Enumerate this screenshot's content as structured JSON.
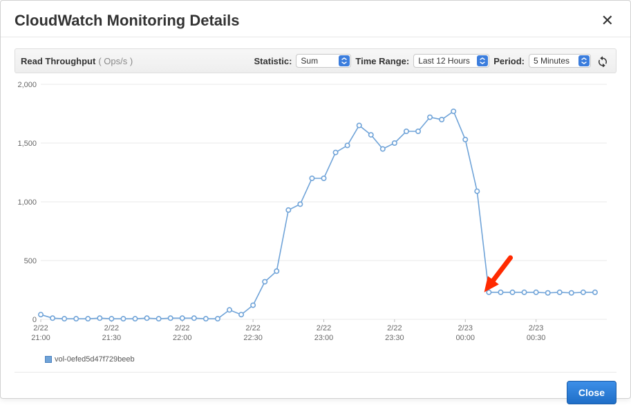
{
  "header": {
    "title": "CloudWatch Monitoring Details"
  },
  "toolbar": {
    "metric_name": "Read Throughput",
    "metric_unit": "( Ops/s )",
    "statistic_label": "Statistic:",
    "statistic_value": "Sum",
    "time_range_label": "Time Range:",
    "time_range_value": "Last 12 Hours",
    "period_label": "Period:",
    "period_value": "5 Minutes"
  },
  "legend": {
    "series_name": "vol-0efed5d47f729beeb"
  },
  "footer": {
    "close_label": "Close"
  },
  "chart_data": {
    "type": "line",
    "title": "",
    "xlabel": "",
    "ylabel": "",
    "ylim": [
      0,
      2000
    ],
    "y_ticks": [
      0,
      500,
      1000,
      1500,
      2000
    ],
    "x_ticks": [
      {
        "minutes": 0,
        "top": "2/22",
        "bottom": "21:00"
      },
      {
        "minutes": 30,
        "top": "2/22",
        "bottom": "21:30"
      },
      {
        "minutes": 60,
        "top": "2/22",
        "bottom": "22:00"
      },
      {
        "minutes": 90,
        "top": "2/22",
        "bottom": "22:30"
      },
      {
        "minutes": 120,
        "top": "2/22",
        "bottom": "23:00"
      },
      {
        "minutes": 150,
        "top": "2/22",
        "bottom": "23:30"
      },
      {
        "minutes": 180,
        "top": "2/23",
        "bottom": "00:00"
      },
      {
        "minutes": 210,
        "top": "2/23",
        "bottom": "00:30"
      }
    ],
    "x_range_minutes": [
      0,
      240
    ],
    "series": [
      {
        "name": "vol-0efed5d47f729beeb",
        "color": "#6fa3d8",
        "x_minutes": [
          0,
          5,
          10,
          15,
          20,
          25,
          30,
          35,
          40,
          45,
          50,
          55,
          60,
          65,
          70,
          75,
          80,
          85,
          90,
          95,
          100,
          105,
          110,
          115,
          120,
          125,
          130,
          135,
          140,
          145,
          150,
          155,
          160,
          165,
          170,
          175,
          180,
          185,
          190,
          195,
          200,
          205,
          210,
          215,
          220,
          225,
          230,
          235
        ],
        "values": [
          40,
          10,
          5,
          5,
          5,
          10,
          5,
          5,
          5,
          10,
          5,
          10,
          10,
          10,
          5,
          5,
          80,
          40,
          120,
          320,
          410,
          930,
          980,
          1200,
          1200,
          1420,
          1480,
          1650,
          1570,
          1450,
          1500,
          1600,
          1600,
          1720,
          1700,
          1770,
          1530,
          1090,
          230,
          230,
          230,
          230,
          230,
          225,
          230,
          225,
          230,
          230
        ]
      }
    ],
    "annotation": {
      "type": "arrow",
      "points_to_x_minutes": 188,
      "points_to_y": 230,
      "color": "#ff2a00"
    }
  }
}
